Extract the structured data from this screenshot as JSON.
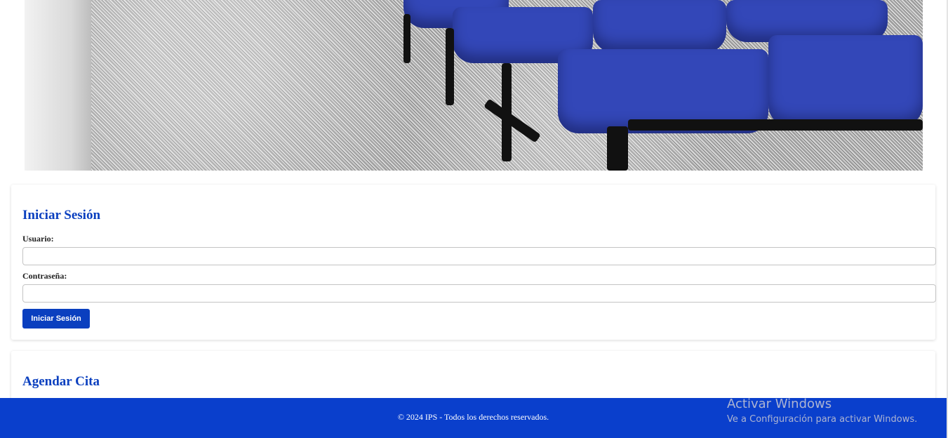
{
  "hero": {
    "image_icon": "waiting-room-chairs-photo"
  },
  "login": {
    "title": "Iniciar Sesión",
    "user_label": "Usuario:",
    "user_value": "",
    "password_label": "Contraseña:",
    "password_value": "",
    "submit_label": "Iniciar Sesión"
  },
  "appointment": {
    "title": "Agendar Cita"
  },
  "footer": {
    "copyright": "© 2024 IPS - Todos los derechos reservados."
  },
  "watermark": {
    "line1": "Activar Windows",
    "line2": "Ve a Configuración para activar Windows."
  },
  "colors": {
    "brand": "#0a3fbf",
    "footer_bg": "#0a3fcc"
  }
}
